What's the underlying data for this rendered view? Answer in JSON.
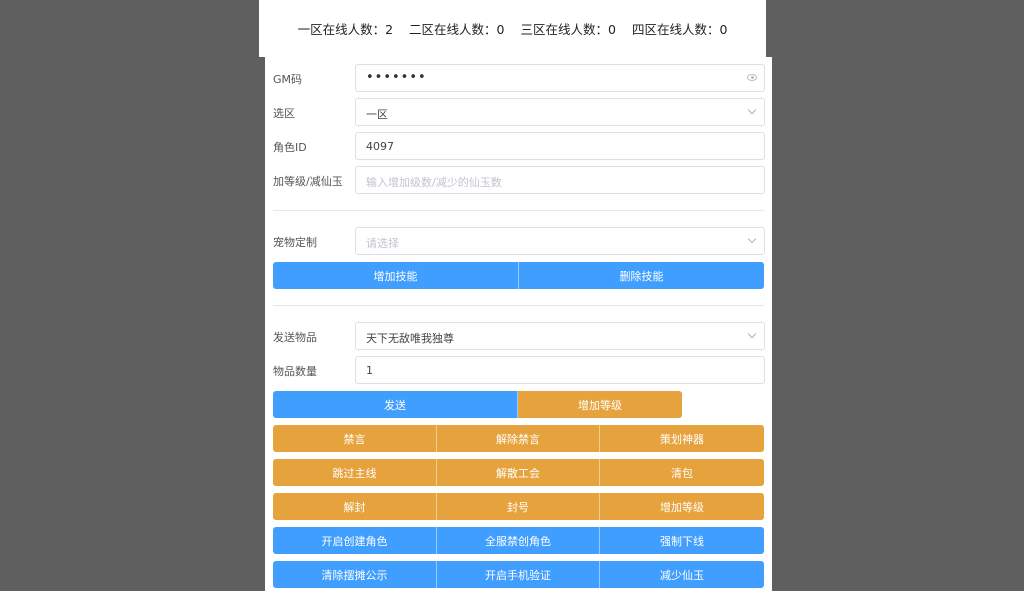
{
  "online": [
    {
      "text": "一区在线人数：2"
    },
    {
      "text": "二区在线人数：0"
    },
    {
      "text": "三区在线人数：0"
    },
    {
      "text": "四区在线人数：0"
    }
  ],
  "form": {
    "gm_code": {
      "label": "GM码",
      "value": "•••••••"
    },
    "zone": {
      "label": "选区",
      "value": "一区"
    },
    "role_id": {
      "label": "角色ID",
      "value": "4097"
    },
    "level_jade": {
      "label": "加等级/减仙玉",
      "placeholder": "输入增加级数/减少的仙玉数"
    },
    "pet": {
      "label": "宠物定制",
      "placeholder": "请选择"
    },
    "send_item": {
      "label": "发送物品",
      "value": "天下无敌唯我独尊"
    },
    "item_qty": {
      "label": "物品数量",
      "value": "1"
    }
  },
  "buttons": {
    "skill_row": [
      "增加技能",
      "删除技能"
    ],
    "send_row": [
      "发送",
      "增加等级"
    ],
    "row_a": [
      "禁言",
      "解除禁言",
      "策划神器"
    ],
    "row_b": [
      "跳过主线",
      "解散工会",
      "清包"
    ],
    "row_c": [
      "解封",
      "封号",
      "增加等级"
    ],
    "row_d": [
      "开启创建角色",
      "全服禁创角色",
      "强制下线"
    ],
    "row_e": [
      "清除摆摊公示",
      "开启手机验证",
      "减少仙玉"
    ]
  },
  "colors": {
    "primary": "#409eff",
    "warning": "#e6a23c",
    "backdrop": "#5f5f5f"
  }
}
